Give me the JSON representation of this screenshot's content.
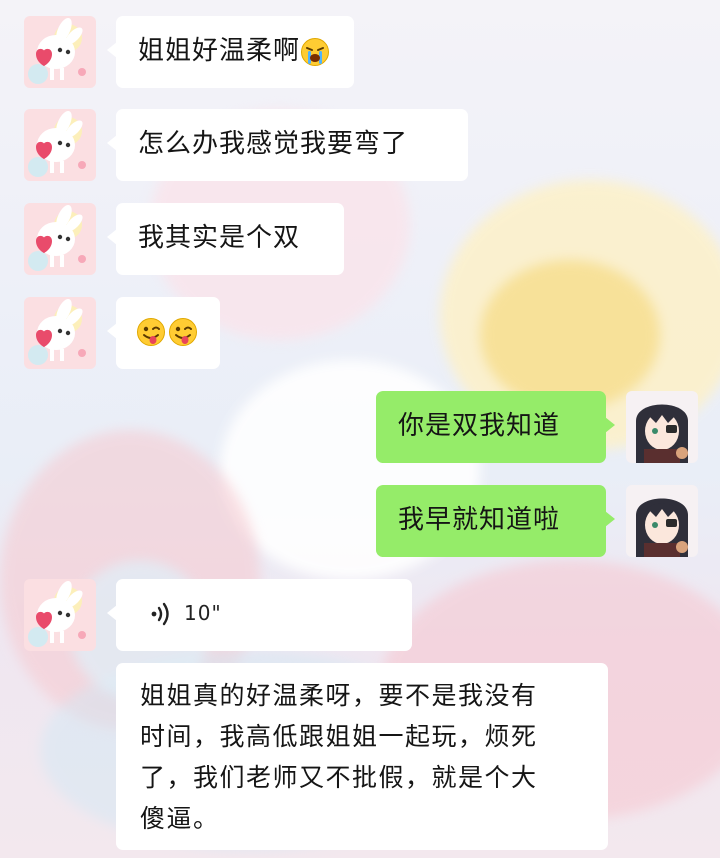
{
  "chat": {
    "messages": [
      {
        "side": "left",
        "text": "姐姐好温柔啊",
        "emoji": "loudly-crying-face"
      },
      {
        "side": "left",
        "text": "怎么办我感觉我要弯了"
      },
      {
        "side": "left",
        "text": "我其实是个双"
      },
      {
        "side": "left",
        "emoji": [
          "winking-face-with-tongue",
          "winking-face-with-tongue"
        ]
      },
      {
        "side": "right",
        "text": "你是双我知道"
      },
      {
        "side": "right",
        "text": "我早就知道啦"
      },
      {
        "side": "left",
        "voice": {
          "duration": "10\""
        }
      },
      {
        "side": "left",
        "lines": [
          "姐姐真的好温柔呀，要不是我没有",
          "时间，我高低跟姐姐一起玩，烦死",
          "了，我们老师又不批假，就是个大",
          "傻逼。"
        ]
      }
    ]
  },
  "colors": {
    "incoming_bubble": "#ffffff",
    "outgoing_bubble": "#95ec69"
  },
  "icons": {
    "contact_avatar": "pink-bunny-avatar",
    "self_avatar": "anime-girl-avatar",
    "voice": "voice-wave-icon"
  }
}
